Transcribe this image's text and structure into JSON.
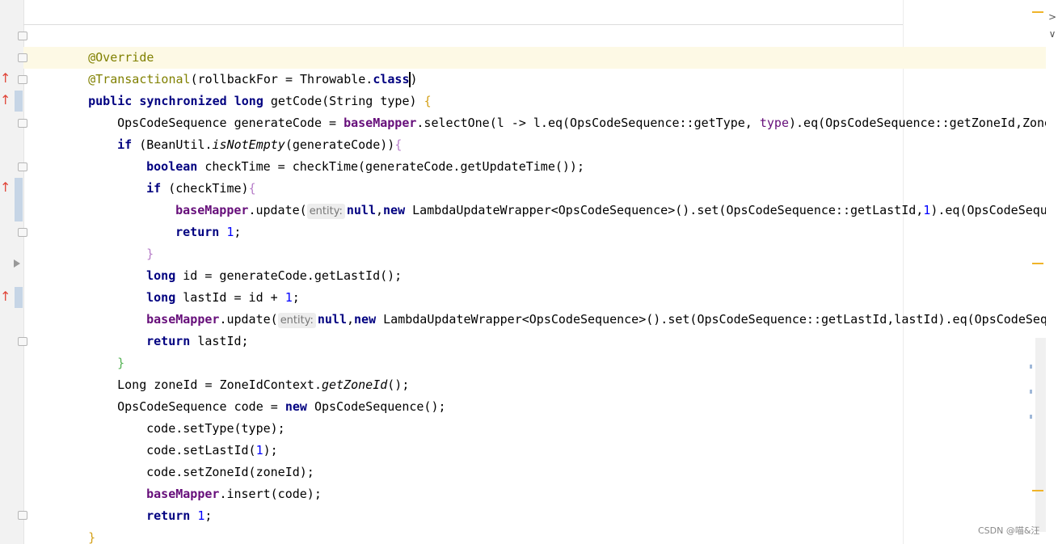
{
  "colors": {
    "keyword": "#000080",
    "annotation": "#808000",
    "field": "#660e7a",
    "number": "#0000ff",
    "caret_line": "#fdf9e5",
    "gutter": "#f2f2f2"
  },
  "icons": {
    "override": "implementing-method-arrow-icon",
    "fold": "fold-marker-icon",
    "fold_collapsed": "collapsed-fold-arrow-icon"
  },
  "code": {
    "l1": {
      "ann": "@Override"
    },
    "l2": {
      "ann": "@Transactional",
      "p1": "(rollbackFor = Throwable.",
      "kw": "class",
      "p2": ")"
    },
    "l3": {
      "k1": "public",
      "s1": " ",
      "k2": "synchronized",
      "s2": " ",
      "k3": "long",
      "rest": " getCode(String type) ",
      "brace": "{"
    },
    "l4": {
      "t1": "OpsCodeSequence generateCode = ",
      "fld": "baseMapper",
      "t2": ".selectOne(l -> l.eq(OpsCodeSequence::getType, ",
      "pm": "type",
      "t3": ").eq(OpsCodeSequence::getZoneId,ZoneIdContext.getZoneId()));"
    },
    "l5": {
      "kw": "if",
      "t1": " (BeanUtil.",
      "it": "isNotEmpty",
      "t2": "(generateCode))",
      "brace": "{"
    },
    "l6": {
      "kw": "boolean",
      "t1": " checkTime = checkTime(generateCode.getUpdateTime());"
    },
    "l7": {
      "kw": "if",
      "t1": " (checkTime)",
      "brace": "{"
    },
    "l8": {
      "fld": "baseMapper",
      "t1": ".update(",
      "hint": "entity:",
      "k1": "null",
      "t2": ",",
      "k2": "new",
      "t3": " LambdaUpdateWrapper<OpsCodeSequence>().set(OpsCodeSequence::getLastId,",
      "num": "1",
      "t4": ").eq(OpsCodeSequence::getId,generateCode.getId()));"
    },
    "l9": {
      "kw": "return",
      "s": " ",
      "num": "1",
      "t": ";"
    },
    "l10": {
      "brace": "}"
    },
    "l11": {
      "kw": "long",
      "t": " id = generateCode.getLastId();"
    },
    "l12": {
      "kw": "long",
      "t": " lastId = id + ",
      "num": "1",
      "t2": ";"
    },
    "l13": {
      "fld": "baseMapper",
      "t1": ".update(",
      "hint": "entity:",
      "k1": "null",
      "t2": ",",
      "k2": "new",
      "t3": " LambdaUpdateWrapper<OpsCodeSequence>().set(OpsCodeSequence::getLastId,lastId).eq(OpsCodeSequence::getId,generateCode.getId()));"
    },
    "l14": {
      "kw": "return",
      "t": " lastId;"
    },
    "l15": {
      "brace": "}"
    },
    "l16": {
      "t1": "Long zoneId = ZoneIdContext.",
      "it": "getZoneId",
      "t2": "();"
    },
    "l17": {
      "t1": "OpsCodeSequence code = ",
      "kw": "new",
      "t2": " OpsCodeSequence();"
    },
    "l18": {
      "t": "code.setType(type);"
    },
    "l19": {
      "t1": "code.setLastId(",
      "num": "1",
      "t2": ");"
    },
    "l20": {
      "t": "code.setZoneId(zoneId);"
    },
    "l21": {
      "fld": "baseMapper",
      "t": ".insert(code);"
    },
    "l22": {
      "kw": "return",
      "s": " ",
      "num": "1",
      "t": ";"
    },
    "l23": {
      "brace": "}"
    }
  },
  "watermark": "CSDN @喵&汪"
}
